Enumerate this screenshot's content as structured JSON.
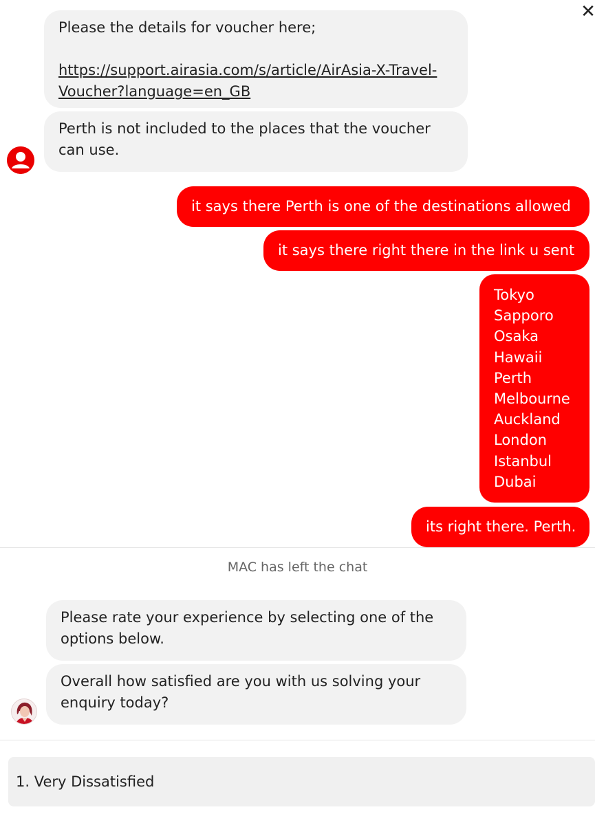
{
  "window": {
    "close_glyph": "✕"
  },
  "agent_messages_top": [
    {
      "line1": "Please the details for voucher here;",
      "link_line1": "https://support.airasia.com/s/article/AirAsia-X-Travel-",
      "link_line2": "Voucher?language=en_GB"
    },
    {
      "line1": "Perth is not included to the places that the voucher",
      "line2": "can use."
    }
  ],
  "user_messages": [
    "it says there Perth is one of the destinations allowed",
    "it says there right there in the link u sent",
    "its right there. Perth."
  ],
  "destinations": [
    "Tokyo",
    "Sapporo",
    "Osaka",
    "Hawaii",
    "Perth",
    "Melbourne",
    "Auckland",
    "London",
    "Istanbul",
    "Dubai"
  ],
  "system_message": "MAC has left the chat",
  "survey_messages": [
    {
      "line1": "Please rate your experience by selecting one of the",
      "line2": "options below."
    },
    {
      "line1": "Overall how satisfied are you with us solving your",
      "line2": "enquiry today?"
    }
  ],
  "survey_option": "1. Very Dissatisfied",
  "colors": {
    "brand_red": "#ff0000",
    "bubble_grey": "#f2f2f2"
  },
  "icons": {
    "user_avatar": "user-avatar-icon",
    "agent_avatar": "agent-avatar-icon",
    "close": "close-icon"
  }
}
